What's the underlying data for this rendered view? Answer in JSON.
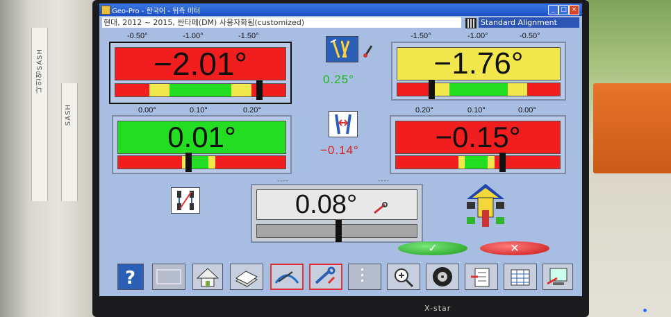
{
  "window": {
    "title": "Geo-Pro - 한국어 - 뒤측 미터",
    "minimize": "_",
    "maximize": "□",
    "close": "×"
  },
  "vehicle": "현대, 2012 ~ 2015, 싼타페(DM) 사용자화됨(customized)",
  "mode": "Standard Alignment",
  "camber": {
    "left": {
      "value": "−2.01°",
      "scale": [
        "-0.50°",
        "-1.00°",
        "-1.50°"
      ]
    },
    "right": {
      "value": "−1.76°",
      "scale": [
        "-1.50°",
        "-1.00°",
        "-0.50°"
      ]
    },
    "cross": "0.25°"
  },
  "toe": {
    "left": {
      "value": "0.01°",
      "scale": [
        "0.00°",
        "0.10°",
        "0.20°"
      ]
    },
    "right": {
      "value": "−0.15°",
      "scale": [
        "0.20°",
        "0.10°",
        "0.00°"
      ]
    },
    "cross": "−0.14°"
  },
  "thrust": {
    "value": "0.08°",
    "dash_left": "----",
    "dash_right": "----"
  },
  "colors": {
    "red": "#f01e1e",
    "yellow": "#f2e84d",
    "green": "#22dd22"
  },
  "ok_glyph": "✓",
  "cancel_glyph": "✕",
  "bezel_brand": "X-star",
  "wall_label": "나인영SASH",
  "wall_label2": "SASH"
}
